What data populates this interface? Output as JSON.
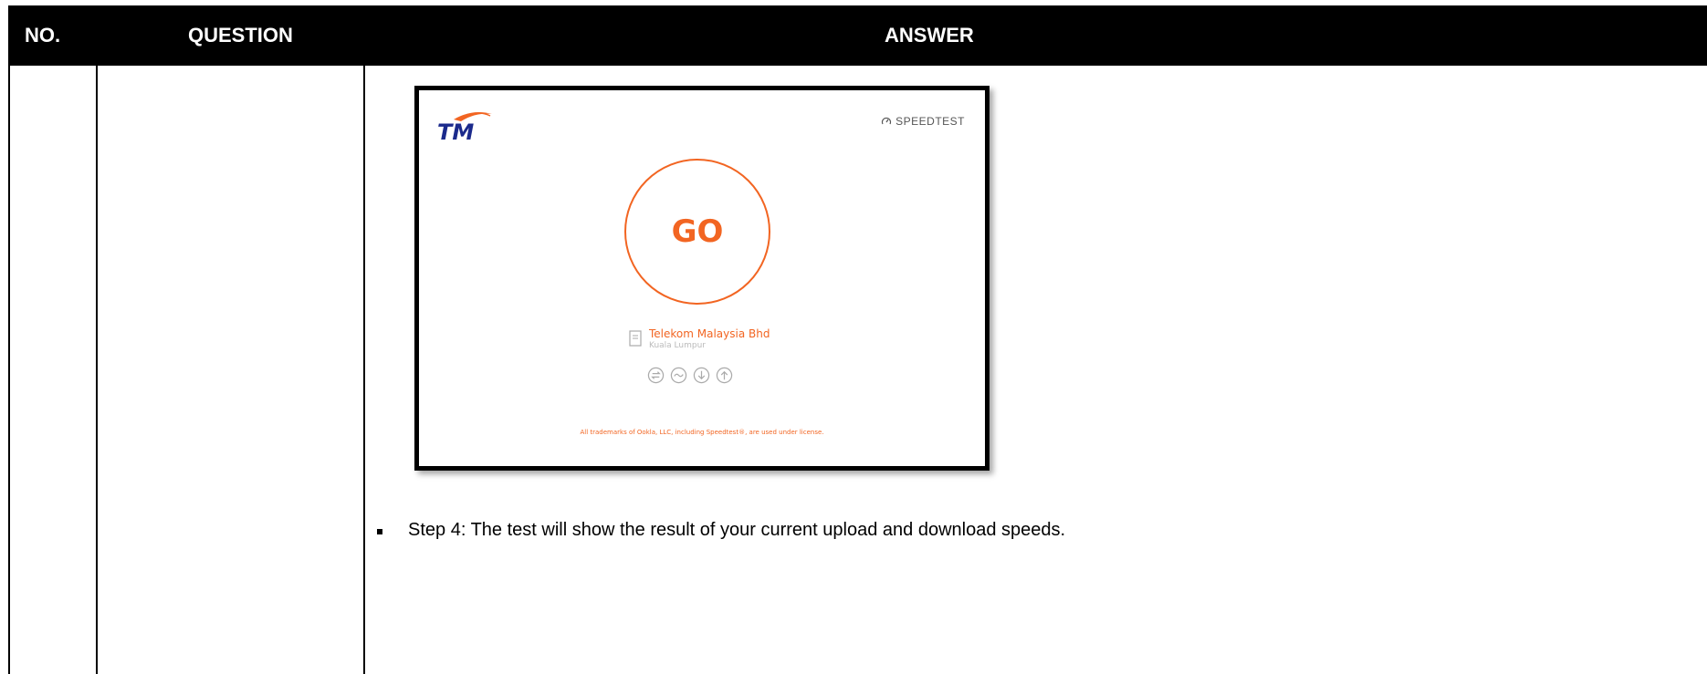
{
  "table": {
    "headers": {
      "no": "NO.",
      "question": "QUESTION",
      "answer": "ANSWER"
    }
  },
  "speedtest_screenshot": {
    "logo_text": "TM",
    "brand_label": "SPEEDTEST",
    "go_label": "GO",
    "isp_name": "Telekom Malaysia Bhd",
    "isp_location": "Kuala Lumpur",
    "icons": [
      "ping-icon",
      "jitter-icon",
      "download-icon",
      "upload-icon"
    ],
    "trademark": "All trademarks of Ookla, LLC, including Speedtest®, are used under license.",
    "accent_color": "#f26522"
  },
  "step_text": "Step 4: The test will show the result of your current upload and download speeds."
}
